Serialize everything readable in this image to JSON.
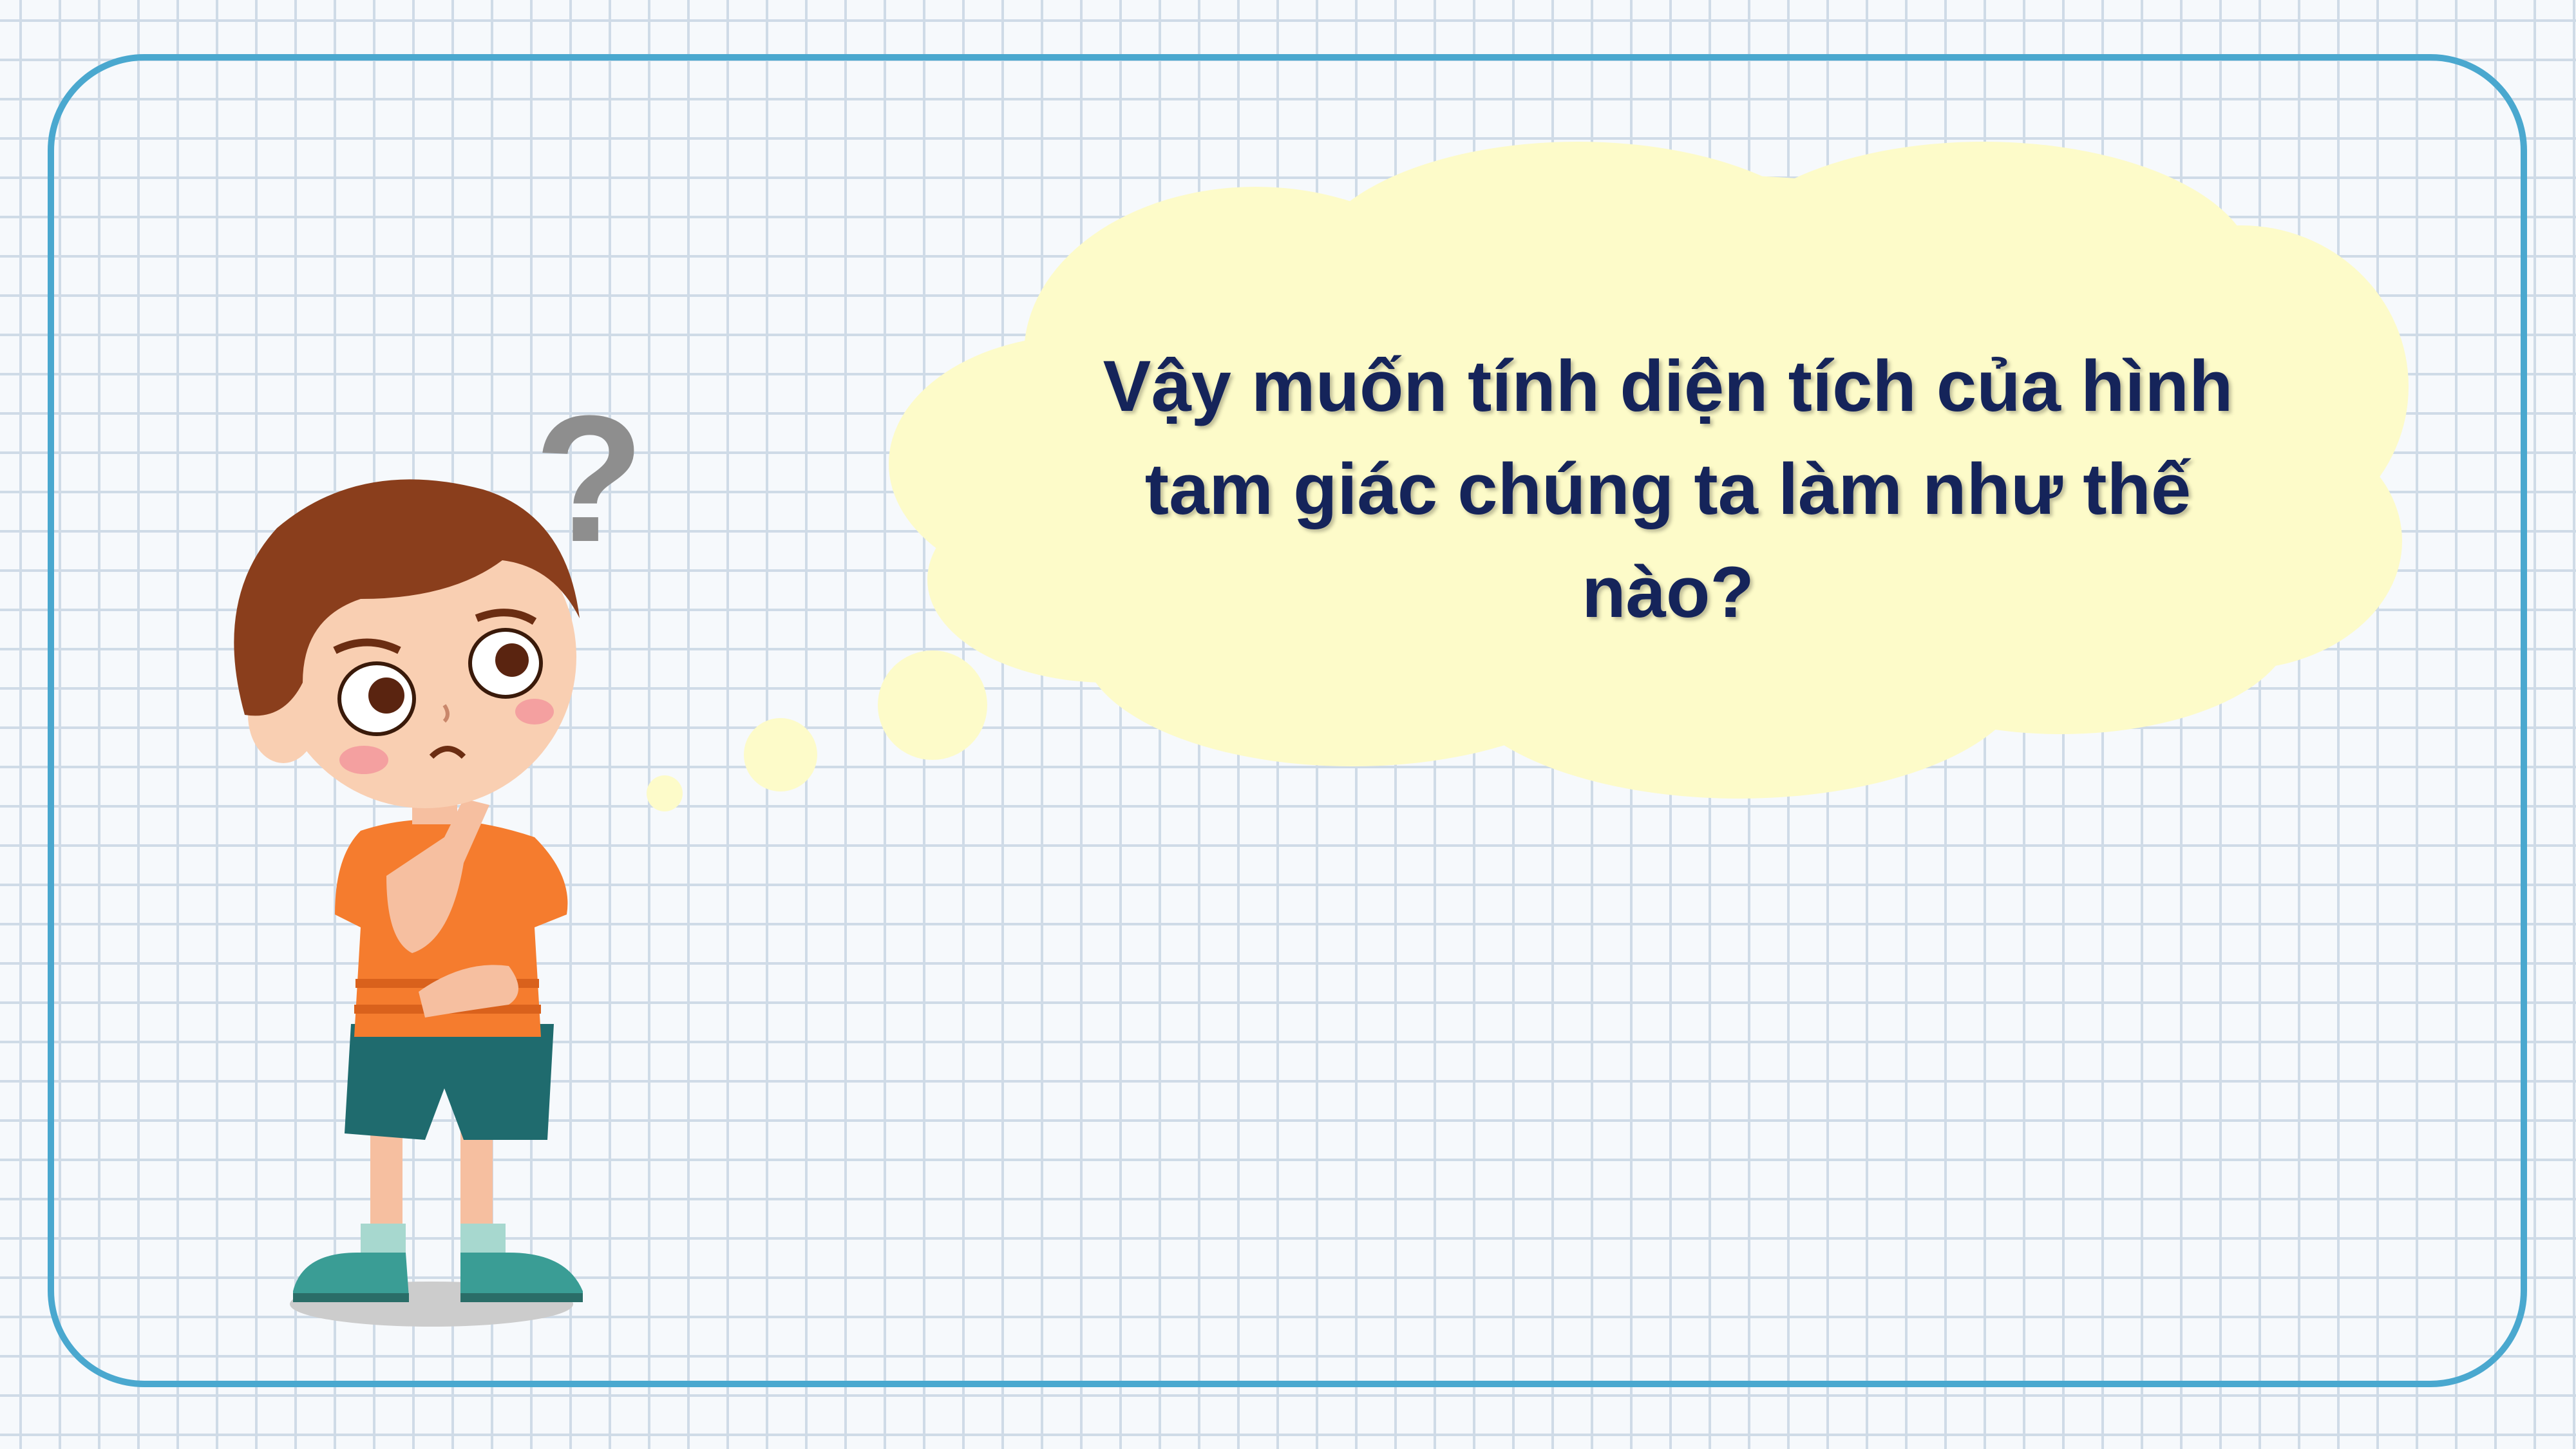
{
  "slide": {
    "question_text": "Vậy muốn tính diện tích của hình tam giác chúng ta làm như thế nào?",
    "question_mark": "?"
  },
  "colors": {
    "frame": "#4aa8cf",
    "grid": "#cfdbe7",
    "bubble": "#fdfbc9",
    "text": "#15245a"
  },
  "icons": {
    "character": "thinking-boy",
    "bubble": "thought-cloud"
  }
}
